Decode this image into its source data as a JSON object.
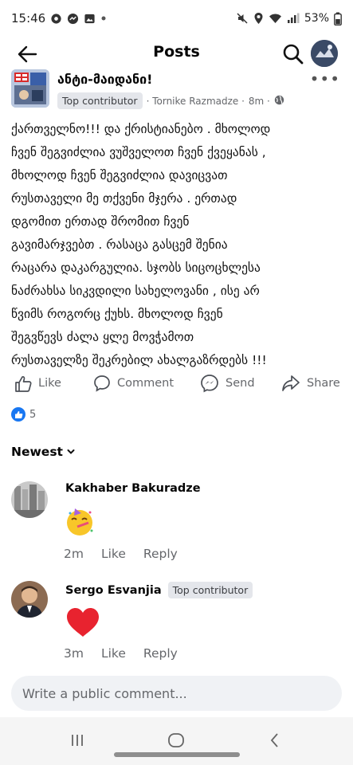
{
  "status": {
    "time": "15:46",
    "battery": "53%"
  },
  "header": {
    "title": "Posts"
  },
  "post": {
    "page_name": "ანტი-მაიდანი!",
    "badge": "Top contributor",
    "author": "· Tornike Razmadze ·",
    "time": "8m ·",
    "text": "ქართველნო!!! და ქრისტიანებო . მხოლოდ\nჩვენ შეგვიძლია ვუშველოთ ჩვენ ქვეყანას ,\nმხოლოდ ჩვენ შეგვიძლია დავიცვათ\nრუსთაველი  მე თქვენი მჯერა .  ერთად\nდგომით ერთად შრომით ჩვენ\nგავიმარჯვებთ . რასაცა გასცემ შენია\nრაცარა დაკარგულია. სჯობს სიცოცხლესა\nნაძრახსა სიკვდილი სახელოვანი  , ისე არ\nწვიმს როგორც ქუხს. მხოლოდ ჩვენ\nშეგვწევს ძალა ყლე მოვჭამოთ\nრუსთაველზე შეკრებილ ახალგაზრდებს !!!",
    "actions": {
      "like": "Like",
      "comment": "Comment",
      "send": "Send",
      "share": "Share"
    },
    "reaction_count": "5"
  },
  "sort": {
    "label": "Newest"
  },
  "comments": [
    {
      "name": "Kakhaber Bakuradze",
      "badge": "",
      "emoji": "🥳",
      "time": "2m",
      "like": "Like",
      "reply": "Reply"
    },
    {
      "name": "Sergo Esvanjia",
      "badge": "Top contributor",
      "emoji": "❤️",
      "time": "3m",
      "like": "Like",
      "reply": "Reply"
    }
  ],
  "composer": {
    "placeholder": "Write a public comment..."
  },
  "colors": {
    "accent": "#1877f2",
    "heart": "#e8232f"
  }
}
